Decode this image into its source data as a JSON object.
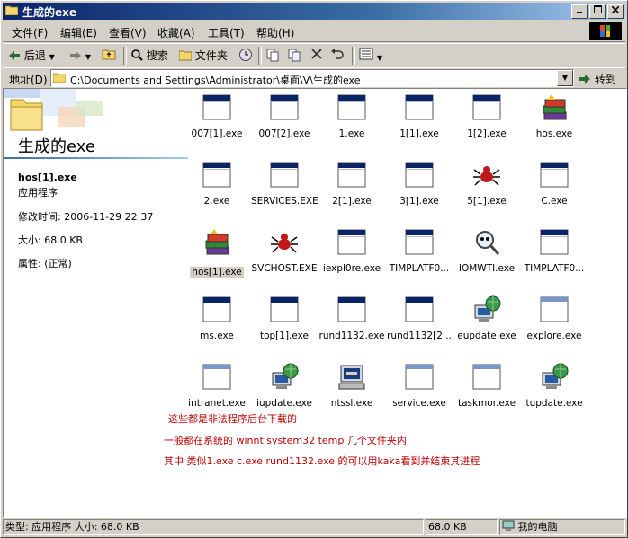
{
  "window": {
    "title": "生成的exe"
  },
  "titlebar_buttons": [
    "minimize-icon",
    "maximize-icon",
    "close-icon"
  ],
  "menu": [
    "文件(F)",
    "编辑(E)",
    "查看(V)",
    "收藏(A)",
    "工具(T)",
    "帮助(H)"
  ],
  "toolbar": {
    "back": "后退",
    "search": "搜索",
    "folders": "文件夹"
  },
  "address": {
    "label": "地址(D)",
    "value": "C:\\Documents and Settings\\Administrator\\桌面\\V\\生成的exe",
    "go": "转到"
  },
  "left_pane": {
    "title": "生成的exe",
    "file_name": "hos[1].exe",
    "file_type": "应用程序",
    "modified": "修改时间: 2006-11-29 22:37",
    "size": "大小: 68.0 KB",
    "attributes": "属性: (正常)"
  },
  "files": [
    {
      "name": "007[1].exe",
      "icon": "window-app-icon"
    },
    {
      "name": "007[2].exe",
      "icon": "window-app-icon"
    },
    {
      "name": "1.exe",
      "icon": "window-app-icon"
    },
    {
      "name": "1[1].exe",
      "icon": "window-app-icon"
    },
    {
      "name": "1[2].exe",
      "icon": "window-app-icon"
    },
    {
      "name": "hos.exe",
      "icon": "books-icon"
    },
    {
      "name": "2.exe",
      "icon": "window-app-icon"
    },
    {
      "name": "SERVICES.EXE",
      "icon": "window-app-icon"
    },
    {
      "name": "2[1].exe",
      "icon": "window-app-icon"
    },
    {
      "name": "3[1].exe",
      "icon": "window-app-icon"
    },
    {
      "name": "5[1].exe",
      "icon": "spider-icon"
    },
    {
      "name": "C.exe",
      "icon": "window-app-icon"
    },
    {
      "name": "hos[1].exe",
      "icon": "books-icon",
      "selected": true
    },
    {
      "name": "SVCHOST.EXE",
      "icon": "spider-icon"
    },
    {
      "name": "iexpl0re.exe",
      "icon": "window-app-icon"
    },
    {
      "name": "TIMPLATF0...",
      "icon": "window-app-icon"
    },
    {
      "name": "IOMWTI.exe",
      "icon": "magnifier-icon"
    },
    {
      "name": "TIMPLATF0...",
      "icon": "window-app-icon"
    },
    {
      "name": "ms.exe",
      "icon": "window-app-icon"
    },
    {
      "name": "top[1].exe",
      "icon": "window-app-icon"
    },
    {
      "name": "rund1132.exe",
      "icon": "window-app-icon"
    },
    {
      "name": "rund1132[2...",
      "icon": "window-app-icon"
    },
    {
      "name": "eupdate.exe",
      "icon": "globe-computer-icon"
    },
    {
      "name": "explore.exe",
      "icon": "blank-window-icon"
    },
    {
      "name": "intranet.exe",
      "icon": "blank-window-icon"
    },
    {
      "name": "iupdate.exe",
      "icon": "globe-computer-icon"
    },
    {
      "name": "ntssl.exe",
      "icon": "computer-icon"
    },
    {
      "name": "service.exe",
      "icon": "blank-window-icon"
    },
    {
      "name": "taskmor.exe",
      "icon": "blank-window-icon"
    },
    {
      "name": "tupdate.exe",
      "icon": "globe-computer-icon"
    }
  ],
  "notes": [
    "这些都是非法程序后台下载的",
    "一般都在系统的 winnt system32 temp 几个文件夹内",
    "其中 类似1.exe c.exe rund1132.exe 的可以用kaka看到并结束其进程"
  ],
  "status": {
    "left": "类型: 应用程序 大小: 68.0 KB",
    "size": "68.0 KB",
    "location": "我的电脑"
  },
  "colors": {
    "titlebar": "#0a246a",
    "note": "#c00000",
    "face": "#d4d0c8"
  }
}
